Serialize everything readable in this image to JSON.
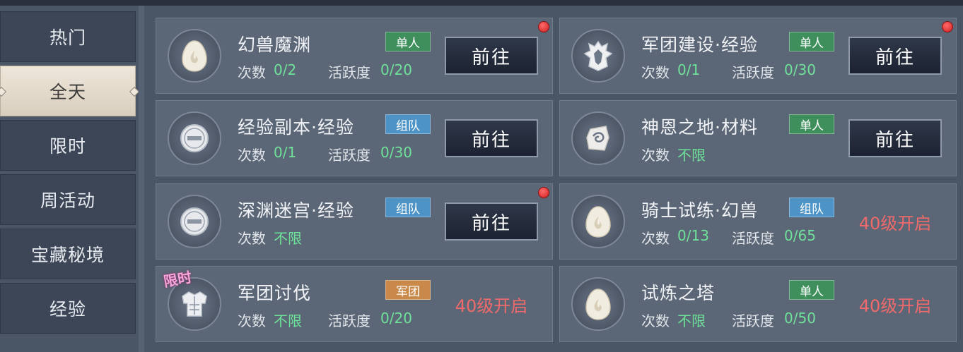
{
  "sidebar": {
    "items": [
      {
        "label": "热门"
      },
      {
        "label": "全天"
      },
      {
        "label": "限时"
      },
      {
        "label": "周活动"
      },
      {
        "label": "宝藏秘境"
      },
      {
        "label": "经验"
      }
    ],
    "active_index": 1
  },
  "labels": {
    "count": "次数",
    "activity": "活跃度"
  },
  "activities": [
    {
      "title": "幻兽魔渊",
      "tag": "单人",
      "count": "0/2",
      "activity": "0/20",
      "action": "前往",
      "icon": "egg-icon",
      "red_dot": true
    },
    {
      "title": "军团建设·经验",
      "tag": "单人",
      "count": "0/1",
      "activity": "0/30",
      "action": "前往",
      "icon": "guild-crest-icon",
      "red_dot": true
    },
    {
      "title": "经验副本·经验",
      "tag": "组队",
      "count": "0/1",
      "activity": "0/30",
      "action": "前往",
      "icon": "exp-badge-icon",
      "red_dot": false
    },
    {
      "title": "神恩之地·材料",
      "tag": "单人",
      "count": "不限",
      "action": "前往",
      "icon": "rune-stone-icon",
      "red_dot": false
    },
    {
      "title": "深渊迷宫·经验",
      "tag": "组队",
      "count": "不限",
      "action": "前往",
      "icon": "exp-badge-icon",
      "red_dot": true
    },
    {
      "title": "骑士试练·幻兽",
      "tag": "组队",
      "count": "0/13",
      "activity": "0/65",
      "lock_text": "40级开启",
      "icon": "egg-icon",
      "red_dot": false
    },
    {
      "title": "军团讨伐",
      "tag": "军团",
      "count": "不限",
      "activity": "0/20",
      "lock_text": "40级开启",
      "icon": "armor-icon",
      "red_dot": false,
      "badge": "限时"
    },
    {
      "title": "试炼之塔",
      "tag": "单人",
      "count": "不限",
      "activity": "0/50",
      "lock_text": "40级开启",
      "icon": "egg-icon",
      "red_dot": false
    }
  ],
  "colors": {
    "value_green": "#6fe29a",
    "lock_red": "#ef6a6a",
    "tag_single": "#3e8f5b",
    "tag_team": "#4d93c6",
    "tag_guild": "#c8894a"
  }
}
